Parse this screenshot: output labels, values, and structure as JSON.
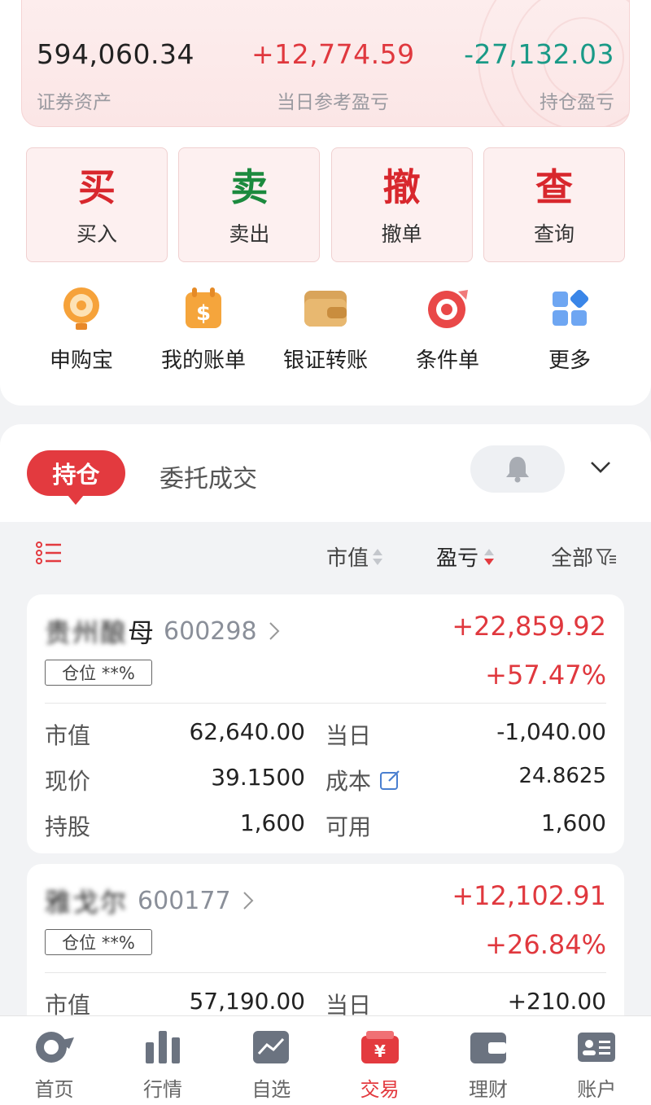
{
  "summary": {
    "securities_assets": "594,060.34",
    "securities_assets_label": "证券资产",
    "daily_pl": "+12,774.59",
    "daily_pl_label": "当日参考盈亏",
    "holding_pl": "-27,132.03",
    "holding_pl_label": "持仓盈亏"
  },
  "trade_buttons": [
    {
      "big": "买",
      "label": "买入",
      "color": "#d8272d"
    },
    {
      "big": "卖",
      "label": "卖出",
      "color": "#1c8a3e"
    },
    {
      "big": "撤",
      "label": "撤单",
      "color": "#d8272d"
    },
    {
      "big": "查",
      "label": "查询",
      "color": "#d8272d"
    }
  ],
  "quick_actions": [
    {
      "label": "申购宝",
      "icon": "bulb-icon"
    },
    {
      "label": "我的账单",
      "icon": "bill-icon"
    },
    {
      "label": "银证转账",
      "icon": "wallet-icon"
    },
    {
      "label": "条件单",
      "icon": "target-icon"
    },
    {
      "label": "更多",
      "icon": "grid-icon"
    }
  ],
  "tabs": {
    "active": "持仓",
    "other": "委托成交"
  },
  "sort_bar": {
    "market_value": "市值",
    "pl": "盈亏",
    "all": "全部"
  },
  "holdings": [
    {
      "name_blurred": "贵州酿",
      "name_tail": "母",
      "code": "600298",
      "position_badge": "仓位 **%",
      "pl_value": "+22,859.92",
      "pl_pct": "+57.47%",
      "market_value_label": "市值",
      "market_value": "62,640.00",
      "today_label": "当日",
      "today": "-1,040.00",
      "price_label": "现价",
      "price": "39.1500",
      "cost_label": "成本",
      "cost": "24.8625",
      "shares_label": "持股",
      "shares": "1,600",
      "available_label": "可用",
      "available": "1,600"
    },
    {
      "name_blurred": "雅戈尔",
      "name_tail": "",
      "code": "600177",
      "position_badge": "仓位 **%",
      "pl_value": "+12,102.91",
      "pl_pct": "+26.84%",
      "market_value_label": "市值",
      "market_value": "57,190.00",
      "today_label": "当日",
      "today": "+210.00"
    }
  ],
  "bottom_nav": [
    {
      "label": "首页",
      "icon": "home-icon"
    },
    {
      "label": "行情",
      "icon": "bar-chart-icon"
    },
    {
      "label": "自选",
      "icon": "trend-icon"
    },
    {
      "label": "交易",
      "icon": "trade-icon",
      "active": true
    },
    {
      "label": "理财",
      "icon": "wallet-icon"
    },
    {
      "label": "账户",
      "icon": "account-icon"
    }
  ]
}
